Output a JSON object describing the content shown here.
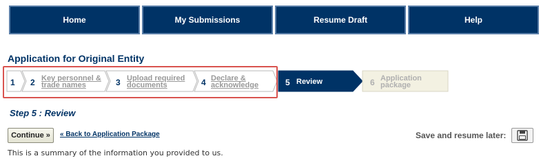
{
  "nav": {
    "home": "Home",
    "submissions": "My Submissions",
    "resume": "Resume Draft",
    "help": "Help"
  },
  "page": {
    "title": "Application for Original Entity"
  },
  "steps": [
    {
      "num": "1",
      "line1": "",
      "line2": "",
      "state": "link"
    },
    {
      "num": "2",
      "line1": "Key personnel &",
      "line2": "trade names",
      "state": "link"
    },
    {
      "num": "3",
      "line1": "Upload required",
      "line2": "documents",
      "state": "link"
    },
    {
      "num": "4",
      "line1": "Declare &",
      "line2": "acknowledge",
      "state": "link"
    },
    {
      "num": "5",
      "line1": "Review",
      "line2": "",
      "state": "active"
    },
    {
      "num": "6",
      "line1": "Application",
      "line2": "package",
      "state": "disabled"
    }
  ],
  "main": {
    "step_heading": "Step 5 : Review",
    "continue_label": "Continue »",
    "back_link": "« Back to Application Package",
    "save_label": "Save and resume later:",
    "summary": "This is a summary of the information you provided to us."
  },
  "colors": {
    "navy": "#003366",
    "highlight": "#d9534f",
    "disabled_fill": "#f3f1e2"
  },
  "icons": {
    "save": "floppy-disk-icon"
  }
}
